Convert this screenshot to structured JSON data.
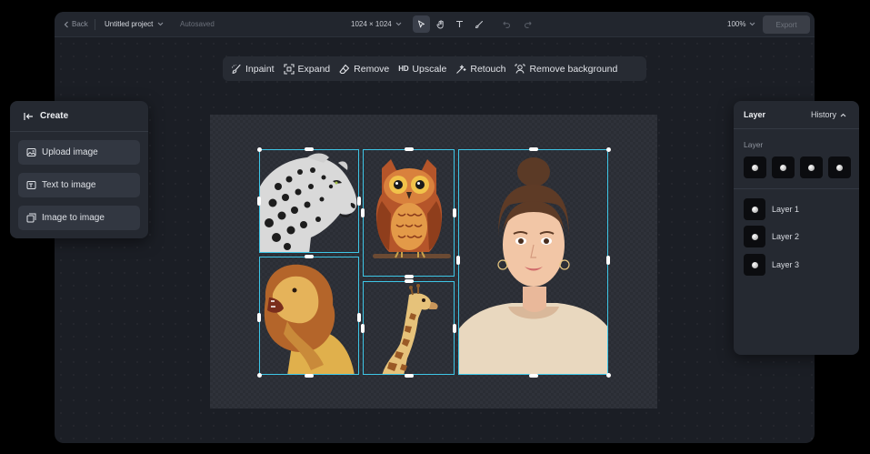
{
  "topbar": {
    "back_label": "Back",
    "project_name": "Untitled project",
    "autosave_status": "Autosaved",
    "canvas_size": "1024 × 1024",
    "zoom": "100%",
    "export_label": "Export"
  },
  "actions": [
    {
      "label": "Inpaint",
      "icon": "inpaint-icon"
    },
    {
      "label": "Expand",
      "icon": "expand-icon"
    },
    {
      "label": "Remove",
      "icon": "eraser-icon"
    },
    {
      "label": "Upscale",
      "icon": "hd-icon",
      "badge": "HD"
    },
    {
      "label": "Retouch",
      "icon": "retouch-icon"
    },
    {
      "label": "Remove background",
      "icon": "remove-background-icon"
    }
  ],
  "create_panel": {
    "title": "Create",
    "items": [
      {
        "label": "Upload image",
        "icon": "upload-image-icon"
      },
      {
        "label": "Text to image",
        "icon": "text-to-image-icon"
      },
      {
        "label": "Image to image",
        "icon": "image-to-image-icon"
      }
    ]
  },
  "layer_panel": {
    "title": "Layer",
    "history_label": "History",
    "section_label": "Layer",
    "layers": [
      {
        "label": "Layer 1"
      },
      {
        "label": "Layer 2"
      },
      {
        "label": "Layer 3"
      }
    ]
  },
  "canvas_images": [
    {
      "name": "leopard-image",
      "subject": "leopard"
    },
    {
      "name": "owl-image",
      "subject": "owl"
    },
    {
      "name": "girl-portrait-image",
      "subject": "portrait"
    },
    {
      "name": "lion-image",
      "subject": "lion"
    },
    {
      "name": "giraffe-image",
      "subject": "giraffe"
    }
  ],
  "colors": {
    "selection": "#3ec6e6",
    "panel": "#252931",
    "window": "#1b1e25"
  }
}
